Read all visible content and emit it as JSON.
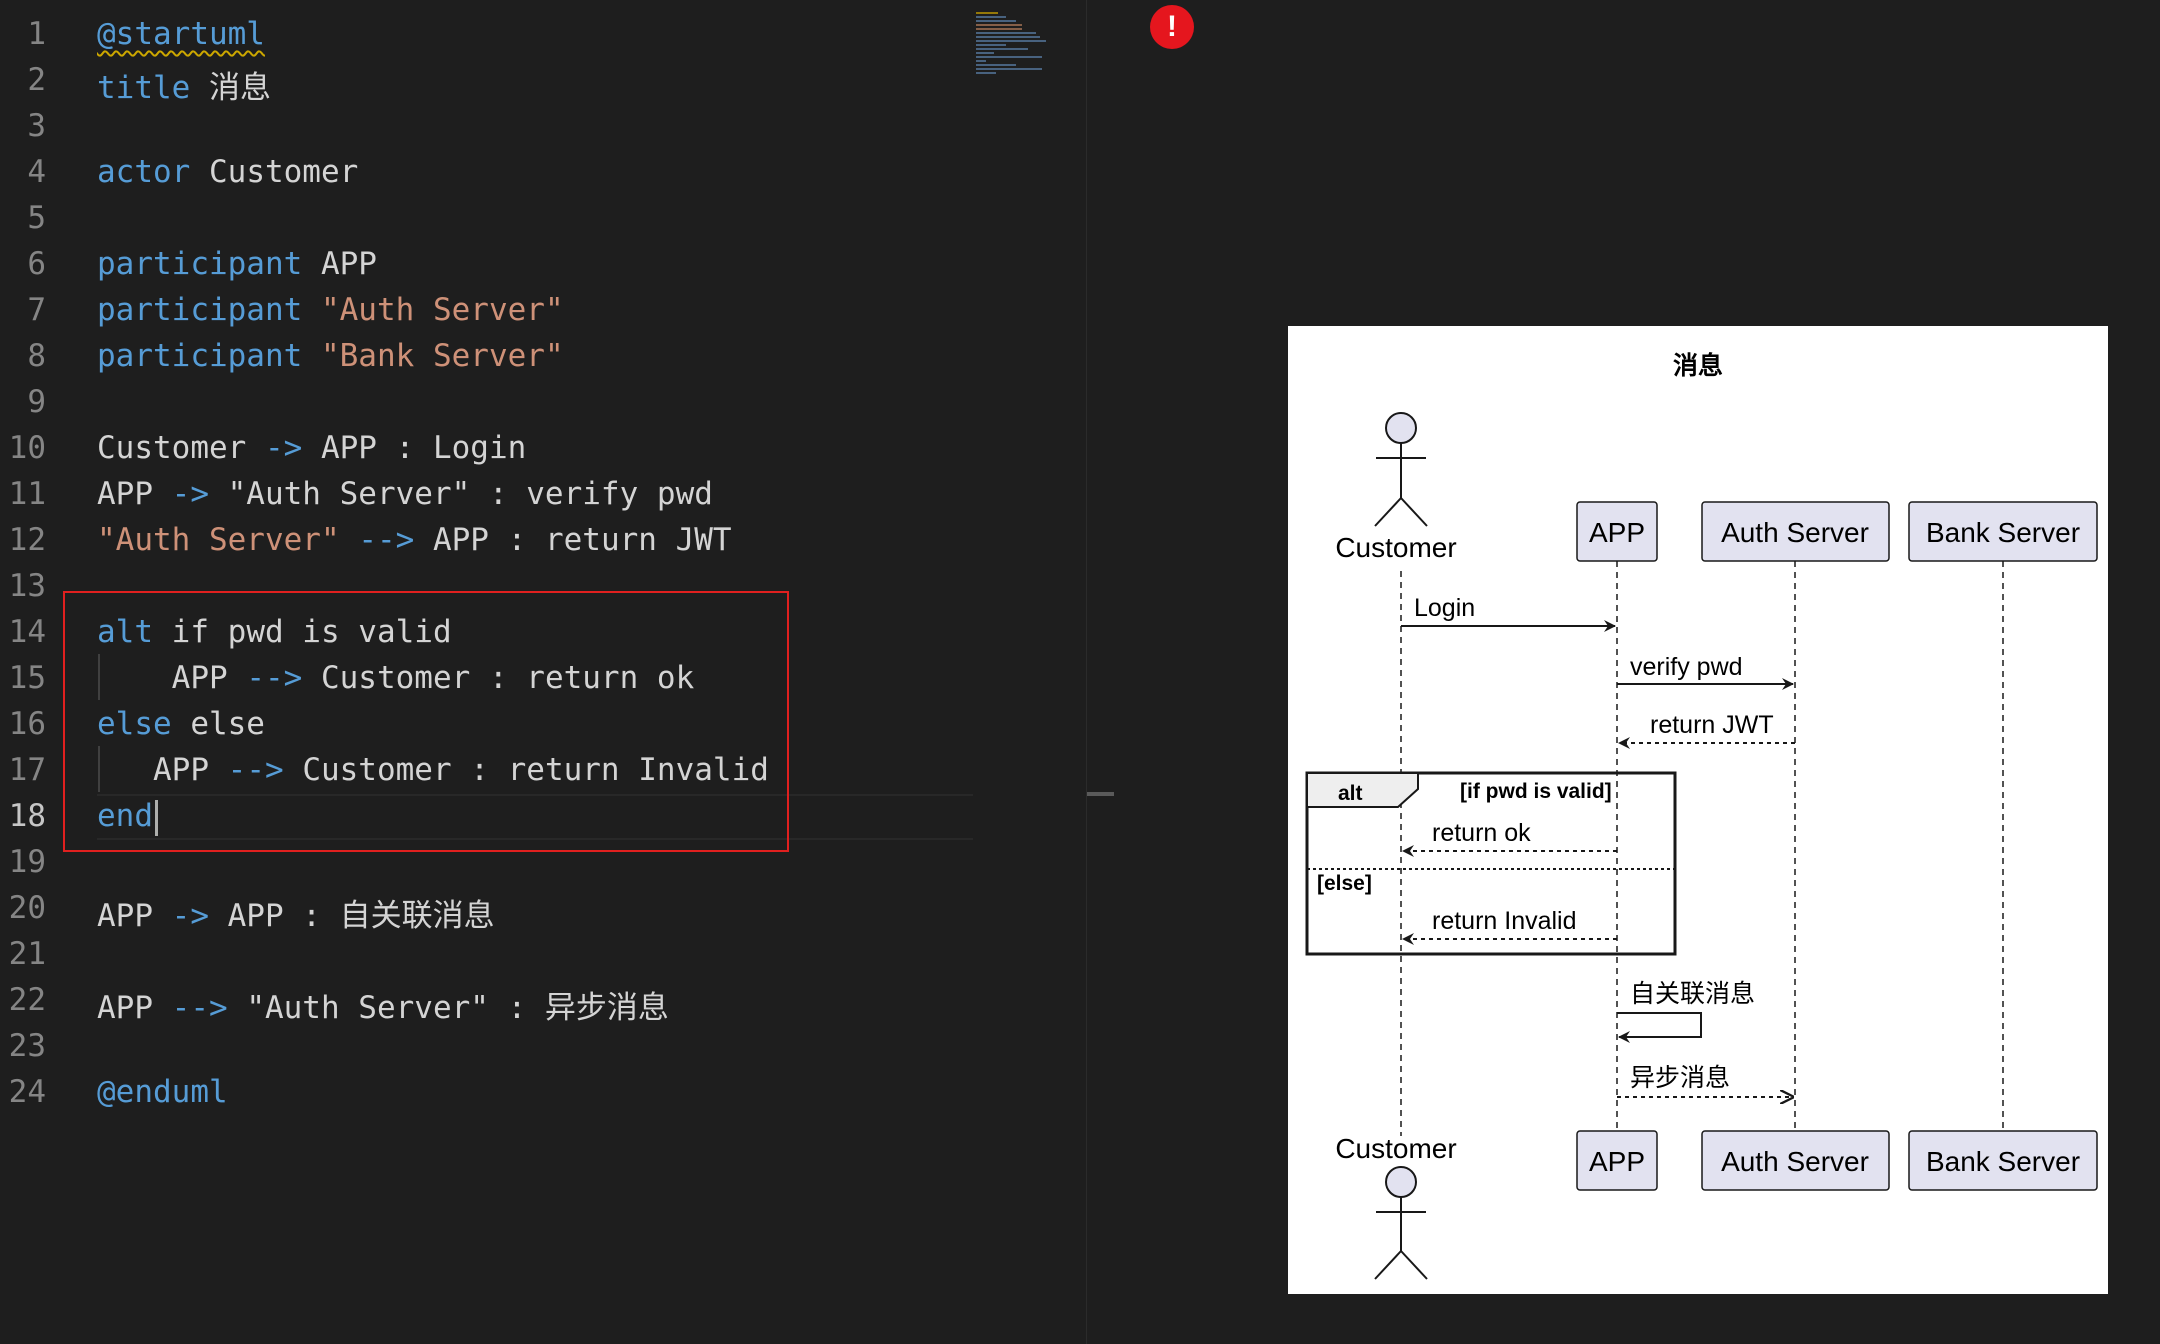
{
  "editor": {
    "lines": [
      {
        "n": "1",
        "tokens": [
          {
            "t": "@startuml",
            "c": "kw squiggle"
          }
        ]
      },
      {
        "n": "2",
        "tokens": [
          {
            "t": "title",
            "c": "kw"
          },
          {
            "t": " 消息",
            "c": ""
          }
        ]
      },
      {
        "n": "3",
        "tokens": []
      },
      {
        "n": "4",
        "tokens": [
          {
            "t": "actor",
            "c": "kw"
          },
          {
            "t": " Customer",
            "c": ""
          }
        ]
      },
      {
        "n": "5",
        "tokens": []
      },
      {
        "n": "6",
        "tokens": [
          {
            "t": "participant",
            "c": "kw"
          },
          {
            "t": " APP",
            "c": ""
          }
        ]
      },
      {
        "n": "7",
        "tokens": [
          {
            "t": "participant",
            "c": "kw"
          },
          {
            "t": " ",
            "c": ""
          },
          {
            "t": "\"Auth Server\"",
            "c": "str"
          }
        ]
      },
      {
        "n": "8",
        "tokens": [
          {
            "t": "participant",
            "c": "kw"
          },
          {
            "t": " ",
            "c": ""
          },
          {
            "t": "\"Bank Server\"",
            "c": "str"
          }
        ]
      },
      {
        "n": "9",
        "tokens": []
      },
      {
        "n": "10",
        "tokens": [
          {
            "t": "Customer ",
            "c": ""
          },
          {
            "t": "->",
            "c": "arr"
          },
          {
            "t": " APP : Login",
            "c": ""
          }
        ]
      },
      {
        "n": "11",
        "tokens": [
          {
            "t": "APP ",
            "c": ""
          },
          {
            "t": "->",
            "c": "arr"
          },
          {
            "t": " \"Auth Server\" : verify pwd",
            "c": ""
          }
        ]
      },
      {
        "n": "12",
        "tokens": [
          {
            "t": "\"Auth Server\"",
            "c": "str"
          },
          {
            "t": " ",
            "c": ""
          },
          {
            "t": "-->",
            "c": "arr"
          },
          {
            "t": " APP : return JWT",
            "c": ""
          }
        ]
      },
      {
        "n": "13",
        "tokens": []
      },
      {
        "n": "14",
        "tokens": [
          {
            "t": "alt",
            "c": "kw"
          },
          {
            "t": " if pwd is valid",
            "c": ""
          }
        ]
      },
      {
        "n": "15",
        "tokens": [
          {
            "t": "    APP ",
            "c": ""
          },
          {
            "t": "-->",
            "c": "arr"
          },
          {
            "t": " Customer : return ok",
            "c": ""
          }
        ]
      },
      {
        "n": "16",
        "tokens": [
          {
            "t": "else",
            "c": "kw"
          },
          {
            "t": " else",
            "c": ""
          }
        ]
      },
      {
        "n": "17",
        "tokens": [
          {
            "t": "   APP ",
            "c": ""
          },
          {
            "t": "-->",
            "c": "arr"
          },
          {
            "t": " Customer : return Invalid",
            "c": ""
          }
        ]
      },
      {
        "n": "18",
        "tokens": [
          {
            "t": "end",
            "c": "kw"
          }
        ],
        "active": true
      },
      {
        "n": "19",
        "tokens": []
      },
      {
        "n": "20",
        "tokens": [
          {
            "t": "APP ",
            "c": ""
          },
          {
            "t": "->",
            "c": "arr"
          },
          {
            "t": " APP : 自关联消息",
            "c": ""
          }
        ]
      },
      {
        "n": "21",
        "tokens": []
      },
      {
        "n": "22",
        "tokens": [
          {
            "t": "APP ",
            "c": ""
          },
          {
            "t": "-->",
            "c": "arr"
          },
          {
            "t": " \"Auth Server\" : 异步消息",
            "c": ""
          }
        ]
      },
      {
        "n": "23",
        "tokens": []
      },
      {
        "n": "24",
        "tokens": [
          {
            "t": "@enduml",
            "c": "kw"
          }
        ]
      }
    ]
  },
  "preview": {
    "error_icon": "!",
    "diagram": {
      "title": "消息",
      "participants": {
        "customer": "Customer",
        "app": "APP",
        "auth": "Auth Server",
        "bank": "Bank Server"
      },
      "messages": {
        "login": "Login",
        "verify": "verify pwd",
        "jwt": "return JWT",
        "ok": "return ok",
        "invalid": "return Invalid",
        "self": "自关联消息",
        "async": "异步消息"
      },
      "fragment": {
        "keyword": "alt",
        "guard": "[if pwd is valid]",
        "else_guard": "[else]"
      }
    }
  },
  "colors": {
    "background": "#1e1e1e",
    "keyword": "#569cd6",
    "string": "#ce9178",
    "text": "#d4d4d4",
    "selection_box": "#e0201f",
    "participant_fill": "#e2e2f0",
    "error": "#e5161e"
  }
}
